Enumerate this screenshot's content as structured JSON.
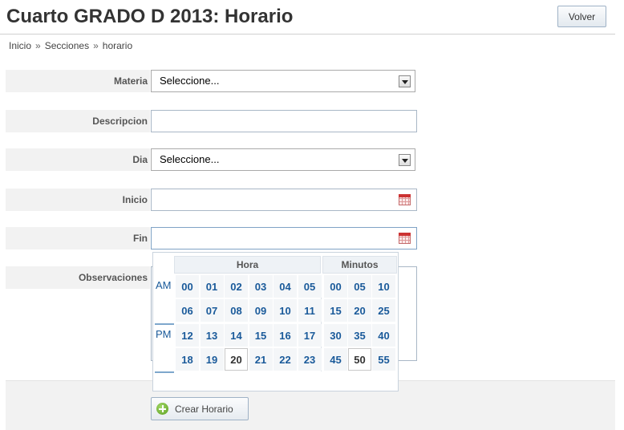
{
  "header": {
    "title": "Cuarto GRADO D 2013: Horario",
    "back_label": "Volver"
  },
  "breadcrumb": {
    "items": [
      "Inicio",
      "Secciones",
      "horario"
    ],
    "separator": "»"
  },
  "form": {
    "materia": {
      "label": "Materia",
      "value": "Seleccione..."
    },
    "descripcion": {
      "label": "Descripcion",
      "value": ""
    },
    "dia": {
      "label": "Dia",
      "value": "Seleccione..."
    },
    "inicio": {
      "label": "Inicio",
      "value": ""
    },
    "fin": {
      "label": "Fin",
      "value": ""
    },
    "observaciones": {
      "label": "Observaciones",
      "value": ""
    },
    "submit_label": "Crear Horario"
  },
  "time_picker": {
    "hour_title": "Hora",
    "minute_title": "Minutos",
    "am_label": "AM",
    "pm_label": "PM",
    "am_hours": [
      [
        "00",
        "01",
        "02",
        "03",
        "04",
        "05"
      ],
      [
        "06",
        "07",
        "08",
        "09",
        "10",
        "11"
      ]
    ],
    "pm_hours": [
      [
        "12",
        "13",
        "14",
        "15",
        "16",
        "17"
      ],
      [
        "18",
        "19",
        "20",
        "21",
        "22",
        "23"
      ]
    ],
    "minutes": [
      [
        "00",
        "05",
        "10"
      ],
      [
        "15",
        "20",
        "25"
      ],
      [
        "30",
        "35",
        "40"
      ],
      [
        "45",
        "50",
        "55"
      ]
    ],
    "selected_hour": "20",
    "selected_minute": "50"
  },
  "icons": {
    "select_arrow": "chevron-down-icon",
    "calendar": "calendar-icon",
    "add": "plus-circle-icon"
  },
  "colors": {
    "link_blue": "#1a5a9a",
    "add_green": "#5a9e1e"
  }
}
